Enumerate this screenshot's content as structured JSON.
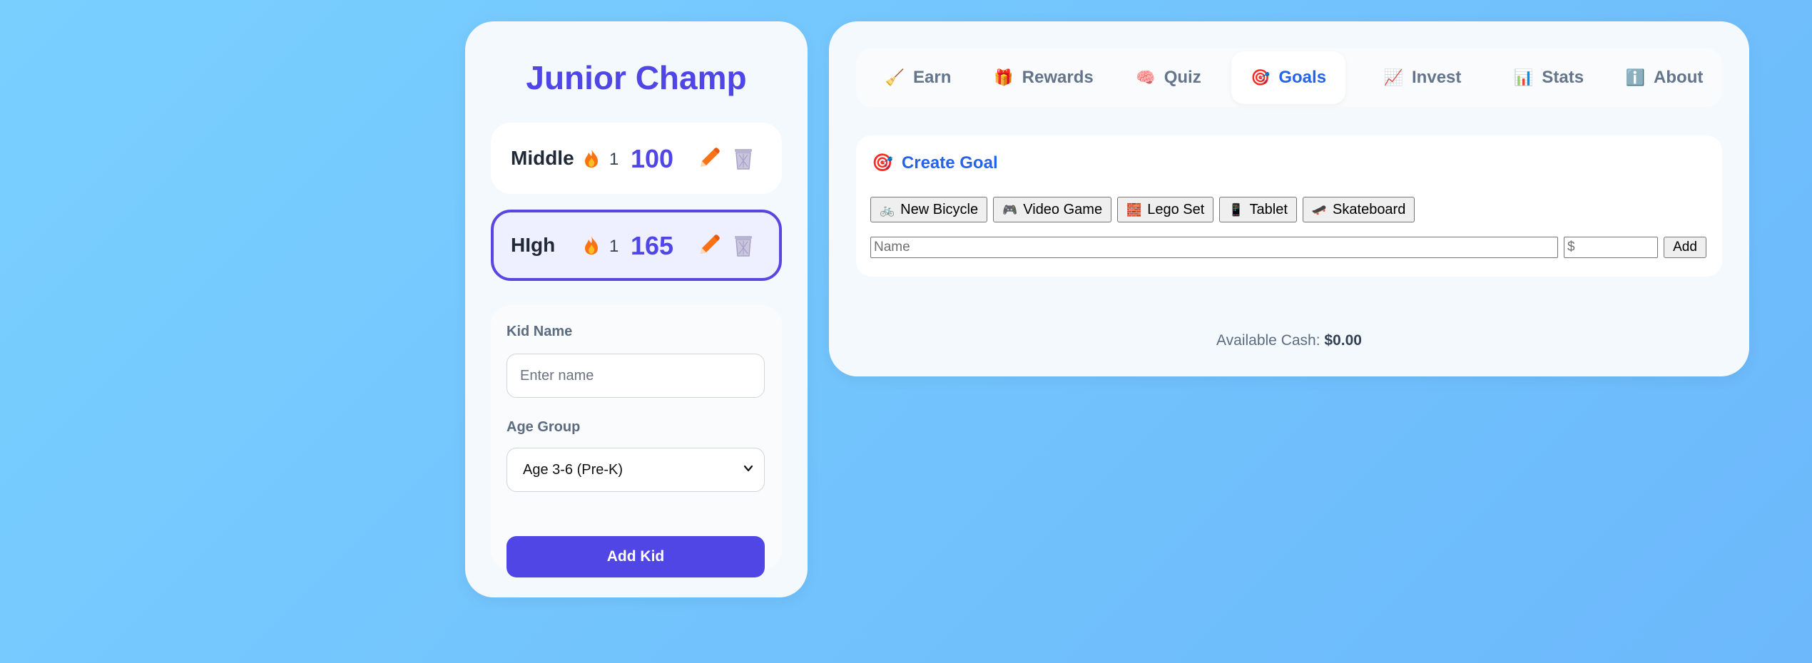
{
  "app": {
    "title": "Junior Champ"
  },
  "kids": [
    {
      "name": "Middle",
      "streak": "1",
      "points": "100",
      "selected": false
    },
    {
      "name": "HIgh",
      "streak": "1",
      "points": "165",
      "selected": true
    }
  ],
  "add_kid_form": {
    "name_label": "Kid Name",
    "name_placeholder": "Enter name",
    "age_label": "Age Group",
    "age_selected": "Age 3-6 (Pre-K)",
    "submit_label": "Add Kid"
  },
  "tabs": [
    {
      "label": "Earn",
      "icon": "🧹",
      "active": false
    },
    {
      "label": "Rewards",
      "icon": "🎁",
      "active": false
    },
    {
      "label": "Quiz",
      "icon": "🧠",
      "active": false
    },
    {
      "label": "Goals",
      "icon": "🎯",
      "active": true
    },
    {
      "label": "Invest",
      "icon": "📈",
      "active": false
    },
    {
      "label": "Stats",
      "icon": "📊",
      "active": false
    },
    {
      "label": "About",
      "icon": "ℹ️",
      "active": false
    }
  ],
  "goals": {
    "heading": "Create Goal",
    "heading_icon": "🎯",
    "presets": [
      {
        "label": "New Bicycle",
        "icon": "🚲"
      },
      {
        "label": "Video Game",
        "icon": "🎮"
      },
      {
        "label": "Lego Set",
        "icon": "🧱"
      },
      {
        "label": "Tablet",
        "icon": "📱"
      },
      {
        "label": "Skateboard",
        "icon": "🛹"
      }
    ],
    "name_placeholder": "Name",
    "amount_placeholder": "$",
    "add_label": "Add"
  },
  "cash": {
    "label": "Available Cash:",
    "value": "$0.00"
  },
  "colors": {
    "brand": "#4f46e5",
    "active_tab": "#2563eb",
    "flame": "#f97316",
    "edit": "#f97316",
    "delete": "#a8a3c6"
  }
}
